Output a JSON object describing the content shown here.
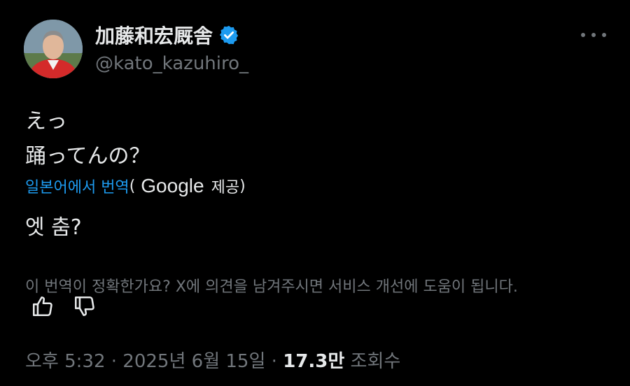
{
  "author": {
    "display_name": "加藤和宏厩舎",
    "handle": "@kato_kazuhiro_"
  },
  "post": {
    "lines": [
      "えっ",
      "踊ってんの？"
    ]
  },
  "translation": {
    "link_label": "일본어에서 번역",
    "open_paren": "(",
    "provider": "Google",
    "provided_label": "제공",
    "close_paren": ")",
    "text": "엣 춤?"
  },
  "feedback_prompt": "이 번역이 정확한가요? X에 의견을 남겨주시면 서비스 개선에 도움이 됩니다.",
  "meta": {
    "time": "오후 5:32",
    "separator": " · ",
    "date": "2025년 6월 15일",
    "views_count": "17.3만",
    "views_label": "조회수"
  },
  "colors": {
    "background": "#000000",
    "text": "#e7e9ea",
    "muted": "#71767b",
    "accent": "#1d9bf0"
  },
  "icons": [
    "verified-badge-icon",
    "more-options-icon",
    "thumbs-up-icon",
    "thumbs-down-icon"
  ]
}
